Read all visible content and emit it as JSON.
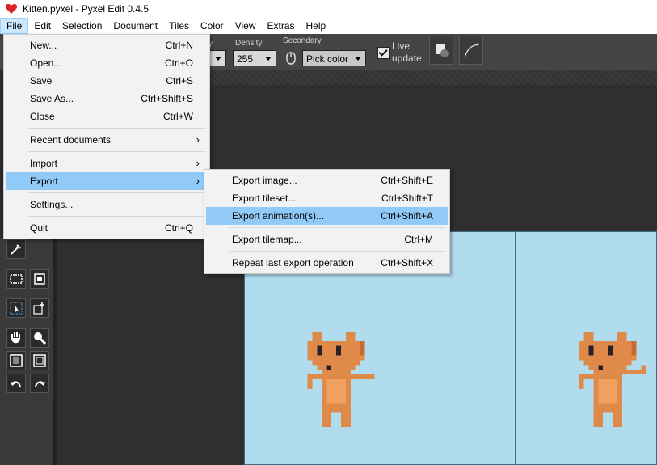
{
  "window": {
    "title": "Kitten.pyxel - Pyxel Edit 0.4.5",
    "icon": "heart-icon"
  },
  "menubar": [
    "File",
    "Edit",
    "Selection",
    "Document",
    "Tiles",
    "Color",
    "View",
    "Extras",
    "Help"
  ],
  "toolbar": {
    "opacity_label_partial": "y",
    "density_label": "Density",
    "density_value": "255",
    "secondary_label": "Secondary",
    "secondary_value": "Pick color",
    "live_update_label_1": "Live",
    "live_update_label_2": "update"
  },
  "file_menu": {
    "items": [
      {
        "label": "New...",
        "shortcut": "Ctrl+N"
      },
      {
        "label": "Open...",
        "shortcut": "Ctrl+O"
      },
      {
        "label": "Save",
        "shortcut": "Ctrl+S"
      },
      {
        "label": "Save As...",
        "shortcut": "Ctrl+Shift+S"
      },
      {
        "label": "Close",
        "shortcut": "Ctrl+W"
      },
      {
        "label": "Recent documents",
        "shortcut": ""
      },
      {
        "label": "Import",
        "shortcut": ""
      },
      {
        "label": "Export",
        "shortcut": ""
      },
      {
        "label": "Settings...",
        "shortcut": ""
      },
      {
        "label": "Quit",
        "shortcut": "Ctrl+Q"
      }
    ]
  },
  "export_menu": {
    "items": [
      {
        "label": "Export image...",
        "shortcut": "Ctrl+Shift+E"
      },
      {
        "label": "Export tileset...",
        "shortcut": "Ctrl+Shift+T"
      },
      {
        "label": "Export animation(s)...",
        "shortcut": "Ctrl+Shift+A"
      },
      {
        "label": "Export tilemap...",
        "shortcut": "Ctrl+M"
      },
      {
        "label": "Repeat last export operation",
        "shortcut": "Ctrl+Shift+X"
      }
    ]
  },
  "colors": {
    "highlight": "#91c9f7",
    "canvas_bg": "#b0dcee",
    "kitten": "#e08a4a"
  }
}
